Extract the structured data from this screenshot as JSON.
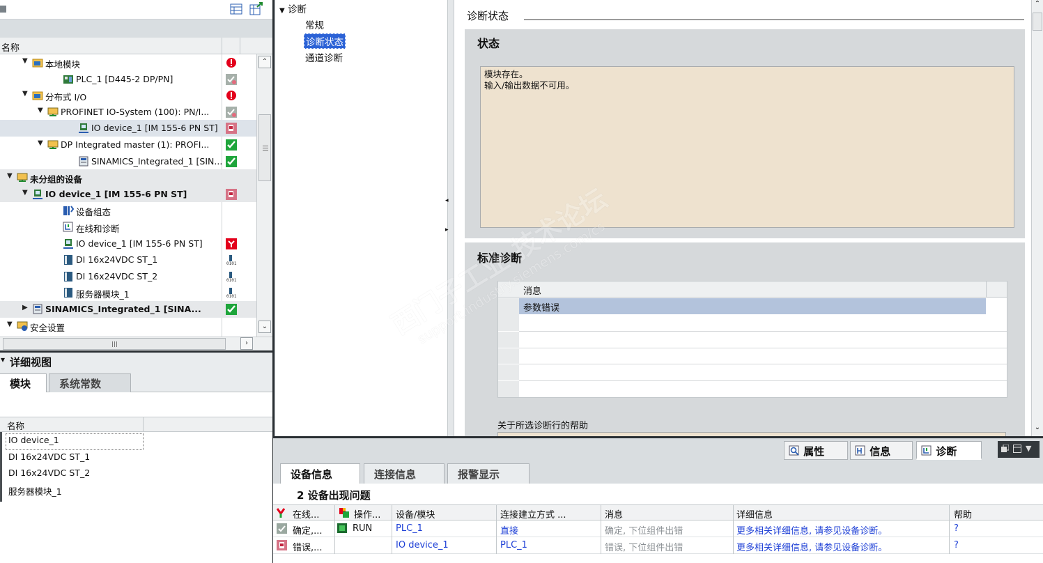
{
  "tree": {
    "header_label": "名称",
    "items": [
      {
        "label": "本地模块",
        "indent": 1,
        "arrow": "▼",
        "icon": "folder-icon",
        "status": "error"
      },
      {
        "label": "PLC_1 [D445-2 DP/PN]",
        "indent": 3,
        "arrow": "",
        "icon": "plc-icon",
        "status": "ok-grey"
      },
      {
        "label": "分布式 I/O",
        "indent": 1,
        "arrow": "▼",
        "icon": "folder-icon",
        "status": "error"
      },
      {
        "label": "PROFINET IO-System (100): PN/I...",
        "indent": 2,
        "arrow": "▼",
        "icon": "network-icon",
        "status": "ok-grey"
      },
      {
        "label": "IO device_1 [IM 155-6 PN ST]",
        "indent": 4,
        "arrow": "",
        "icon": "device-icon",
        "status": "fault"
      },
      {
        "label": "DP Integrated master (1): PROFI...",
        "indent": 2,
        "arrow": "▼",
        "icon": "network-icon",
        "status": "ok"
      },
      {
        "label": "SINAMICS_Integrated_1 [SIN...",
        "indent": 4,
        "arrow": "",
        "icon": "drive-icon",
        "status": "ok"
      },
      {
        "label": "未分组的设备",
        "indent": 0,
        "arrow": "▼",
        "icon": "network-icon",
        "bold": true,
        "status": ""
      },
      {
        "label": "IO device_1 [IM 155-6 PN ST]",
        "indent": 1,
        "arrow": "▼",
        "icon": "device-icon",
        "bold": true,
        "status": "fault"
      },
      {
        "label": "设备组态",
        "indent": 3,
        "arrow": "",
        "icon": "config-icon",
        "status": ""
      },
      {
        "label": "在线和诊断",
        "indent": 3,
        "arrow": "",
        "icon": "diagnostics-icon",
        "status": ""
      },
      {
        "label": "IO device_1 [IM 155-6 PN ST]",
        "indent": 3,
        "arrow": "",
        "icon": "device-icon",
        "status": "maint"
      },
      {
        "label": "DI 16x24VDC ST_1",
        "indent": 3,
        "arrow": "",
        "icon": "module-icon",
        "status": "io"
      },
      {
        "label": "DI 16x24VDC ST_2",
        "indent": 3,
        "arrow": "",
        "icon": "module-icon",
        "status": "io"
      },
      {
        "label": "服务器模块_1",
        "indent": 3,
        "arrow": "",
        "icon": "module-icon",
        "status": "io"
      },
      {
        "label": "SINAMICS_Integrated_1 [SINA...",
        "indent": 1,
        "arrow": "▶",
        "icon": "drive-icon",
        "bold": true,
        "status": "ok"
      },
      {
        "label": "安全设置",
        "indent": 0,
        "arrow": "▼",
        "icon": "security-icon",
        "status": ""
      }
    ]
  },
  "detail": {
    "title": "详细视图",
    "tabs": [
      "模块",
      "系统常数"
    ],
    "header_label": "名称",
    "rows": [
      "IO device_1",
      "DI 16x24VDC ST_1",
      "DI 16x24VDC ST_2",
      "服务器模块_1"
    ]
  },
  "nav": {
    "root": "诊断",
    "items": [
      "常规",
      "诊断状态",
      "通道诊断"
    ]
  },
  "main": {
    "section_title": "诊断状态",
    "status_title": "状态",
    "status_lines": [
      "模块存在。",
      "输入/输出数据不可用。"
    ],
    "std_title": "标准诊断",
    "msg_header": "消息",
    "msg_rows": [
      "参数错误"
    ],
    "help_label": "关于所选诊断行的帮助",
    "watermark_cn": "西门子工业 技术论坛",
    "watermark_url": "support.industry.siemens.com/cs"
  },
  "inspector": {
    "tabs": [
      {
        "label": "属性",
        "icon": "properties-icon"
      },
      {
        "label": "信息",
        "icon": "info-icon"
      },
      {
        "label": "诊断",
        "icon": "diagnostics-icon"
      }
    ],
    "subtabs": [
      "设备信息",
      "连接信息",
      "报警显示"
    ],
    "problem_text": "2 设备出现问题",
    "columns": [
      "在线...",
      "操作...",
      "设备/模块",
      "连接建立方式 ...",
      "消息",
      "详细信息",
      "帮助"
    ],
    "rows": [
      {
        "online": "确定,...",
        "op": "RUN",
        "device": "PLC_1",
        "conn": "直接",
        "msg": "确定, 下位组件出错",
        "detail": "更多相关详细信息, 请参见设备诊断。",
        "help": "?"
      },
      {
        "online": "错误,...",
        "op": "",
        "device": "IO device_1",
        "conn": "PLC_1",
        "msg": "错误, 下位组件出错",
        "detail": "更多相关详细信息, 请参见设备诊断。",
        "help": "?"
      }
    ]
  },
  "colors": {
    "status_box": "#eee2cf",
    "panel_grey": "#d6d9db",
    "link": "#1d3fd6",
    "ok_green": "#1ea53b",
    "error_red": "#e3001b",
    "selected_nav": "#2b62d6"
  }
}
